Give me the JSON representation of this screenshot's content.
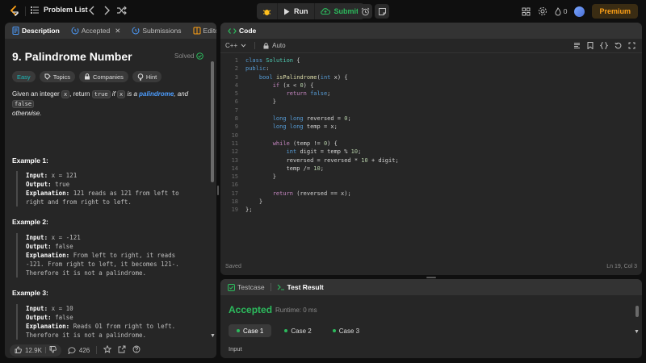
{
  "topbar": {
    "problem_list": "Problem List",
    "run": "Run",
    "submit": "Submit",
    "streak": "0",
    "premium": "Premium"
  },
  "left": {
    "tabs": [
      {
        "label": "Description"
      },
      {
        "label": "Accepted"
      },
      {
        "label": "Submissions"
      },
      {
        "label": "Editorial"
      }
    ],
    "title": "9. Palindrome Number",
    "solved": "Solved",
    "chips": [
      "Easy",
      "Topics",
      "Companies",
      "Hint"
    ],
    "desc": {
      "p1": "Given an integer ",
      "x": "x",
      "p2": ", return ",
      "true": "true",
      "p3": " if ",
      "x2": "x",
      "p4": " is a ",
      "link": "palindrome",
      "p5": ", and ",
      "false": "false",
      "p6": "otherwise."
    },
    "examples": [
      {
        "title": "Example 1:",
        "input_lbl": "Input:",
        "input": " x = 121",
        "output_lbl": "Output:",
        "output": " true",
        "expl_lbl": "Explanation:",
        "expl1": " 121 reads as 121 from left to",
        "expl2": "right and from right to left.",
        "expl3": ""
      },
      {
        "title": "Example 2:",
        "input_lbl": "Input:",
        "input": " x = -121",
        "output_lbl": "Output:",
        "output": " false",
        "expl_lbl": "Explanation:",
        "expl1": " From left to right, it reads",
        "expl2": "-121. From right to left, it becomes 121-.",
        "expl3": "Therefore it is not a palindrome."
      },
      {
        "title": "Example 3:",
        "input_lbl": "Input:",
        "input": " x = 10",
        "output_lbl": "Output:",
        "output": " false",
        "expl_lbl": "Explanation:",
        "expl1": " Reads 01 from right to left.",
        "expl2": "Therefore it is not a palindrome.",
        "expl3": ""
      }
    ],
    "footer": {
      "likes": "12.9K",
      "comments": "426"
    }
  },
  "editor": {
    "tab": "Code",
    "language": "C++",
    "auto": "Auto",
    "saved": "Saved",
    "cursor": "Ln 19, Col 3",
    "line_count": 19
  },
  "test": {
    "tabs": [
      {
        "label": "Testcase"
      },
      {
        "label": "Test Result"
      }
    ],
    "status": "Accepted",
    "runtime": "Runtime: 0 ms",
    "cases": [
      "Case 1",
      "Case 2",
      "Case 3"
    ],
    "input_label": "Input"
  },
  "colors": {
    "accent": "#ffa116",
    "success": "#2cbb5d",
    "link": "#4c9dff",
    "easy": "#1cbaba"
  }
}
